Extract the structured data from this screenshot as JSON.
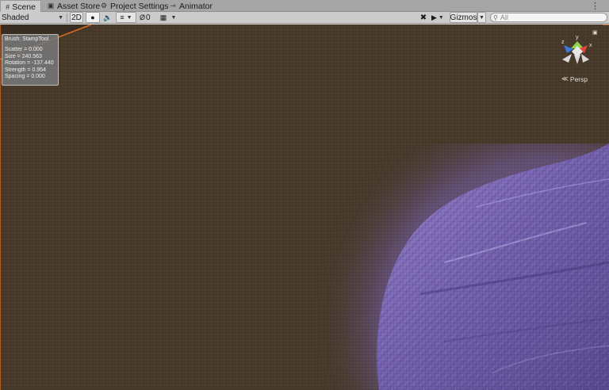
{
  "tabs": [
    {
      "label": "Scene",
      "icon": "scene-grid-icon",
      "active": true
    },
    {
      "label": "Asset Store",
      "icon": "store-icon",
      "active": false
    },
    {
      "label": "Project Settings",
      "icon": "gear-icon",
      "active": false
    },
    {
      "label": "Animator",
      "icon": "animator-icon",
      "active": false
    }
  ],
  "toolbar": {
    "shading_mode": "Shaded",
    "mode_2d": "2D",
    "hidden_count": "0",
    "gizmos_label": "Gizmos",
    "search_placeholder": "All"
  },
  "brush_info": {
    "title": "Brush: StampTool",
    "lines": [
      "Scatter = 0.000",
      "Size = 240.563",
      "Rotation = -137.440",
      "Strength = 0.954",
      "Spacing = 0.000"
    ]
  },
  "orientation": {
    "axis_y": "y",
    "axis_x": "x",
    "axis_z": "z",
    "projection": "Persp"
  },
  "colors": {
    "ground": "#4a3b2b",
    "terrain": "#7a66b8",
    "border_highlight": "#e07020",
    "axis_x": "#e0453a",
    "axis_y": "#8fd14f",
    "axis_z": "#3a7be0"
  }
}
